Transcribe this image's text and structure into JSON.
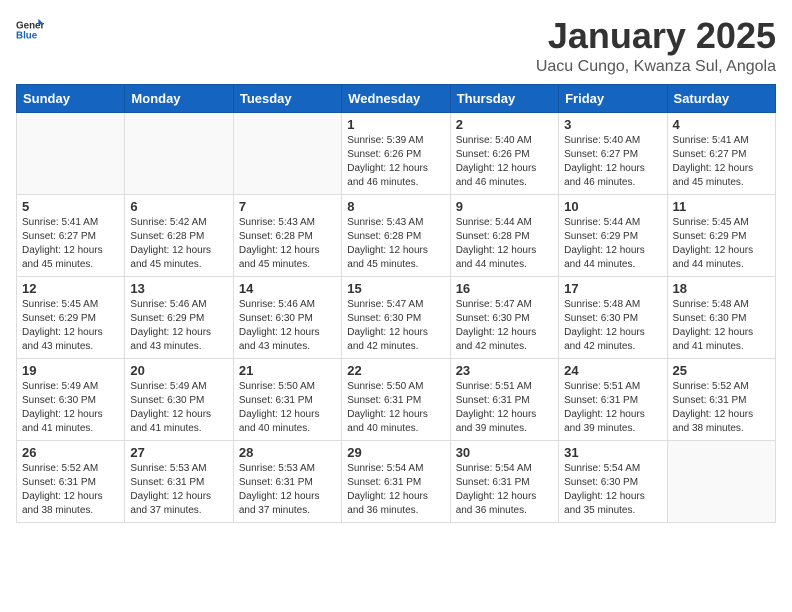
{
  "logo": {
    "general": "General",
    "blue": "Blue"
  },
  "header": {
    "month": "January 2025",
    "location": "Uacu Cungo, Kwanza Sul, Angola"
  },
  "weekdays": [
    "Sunday",
    "Monday",
    "Tuesday",
    "Wednesday",
    "Thursday",
    "Friday",
    "Saturday"
  ],
  "weeks": [
    [
      {
        "day": "",
        "info": ""
      },
      {
        "day": "",
        "info": ""
      },
      {
        "day": "",
        "info": ""
      },
      {
        "day": "1",
        "info": "Sunrise: 5:39 AM\nSunset: 6:26 PM\nDaylight: 12 hours\nand 46 minutes."
      },
      {
        "day": "2",
        "info": "Sunrise: 5:40 AM\nSunset: 6:26 PM\nDaylight: 12 hours\nand 46 minutes."
      },
      {
        "day": "3",
        "info": "Sunrise: 5:40 AM\nSunset: 6:27 PM\nDaylight: 12 hours\nand 46 minutes."
      },
      {
        "day": "4",
        "info": "Sunrise: 5:41 AM\nSunset: 6:27 PM\nDaylight: 12 hours\nand 45 minutes."
      }
    ],
    [
      {
        "day": "5",
        "info": "Sunrise: 5:41 AM\nSunset: 6:27 PM\nDaylight: 12 hours\nand 45 minutes."
      },
      {
        "day": "6",
        "info": "Sunrise: 5:42 AM\nSunset: 6:28 PM\nDaylight: 12 hours\nand 45 minutes."
      },
      {
        "day": "7",
        "info": "Sunrise: 5:43 AM\nSunset: 6:28 PM\nDaylight: 12 hours\nand 45 minutes."
      },
      {
        "day": "8",
        "info": "Sunrise: 5:43 AM\nSunset: 6:28 PM\nDaylight: 12 hours\nand 45 minutes."
      },
      {
        "day": "9",
        "info": "Sunrise: 5:44 AM\nSunset: 6:28 PM\nDaylight: 12 hours\nand 44 minutes."
      },
      {
        "day": "10",
        "info": "Sunrise: 5:44 AM\nSunset: 6:29 PM\nDaylight: 12 hours\nand 44 minutes."
      },
      {
        "day": "11",
        "info": "Sunrise: 5:45 AM\nSunset: 6:29 PM\nDaylight: 12 hours\nand 44 minutes."
      }
    ],
    [
      {
        "day": "12",
        "info": "Sunrise: 5:45 AM\nSunset: 6:29 PM\nDaylight: 12 hours\nand 43 minutes."
      },
      {
        "day": "13",
        "info": "Sunrise: 5:46 AM\nSunset: 6:29 PM\nDaylight: 12 hours\nand 43 minutes."
      },
      {
        "day": "14",
        "info": "Sunrise: 5:46 AM\nSunset: 6:30 PM\nDaylight: 12 hours\nand 43 minutes."
      },
      {
        "day": "15",
        "info": "Sunrise: 5:47 AM\nSunset: 6:30 PM\nDaylight: 12 hours\nand 42 minutes."
      },
      {
        "day": "16",
        "info": "Sunrise: 5:47 AM\nSunset: 6:30 PM\nDaylight: 12 hours\nand 42 minutes."
      },
      {
        "day": "17",
        "info": "Sunrise: 5:48 AM\nSunset: 6:30 PM\nDaylight: 12 hours\nand 42 minutes."
      },
      {
        "day": "18",
        "info": "Sunrise: 5:48 AM\nSunset: 6:30 PM\nDaylight: 12 hours\nand 41 minutes."
      }
    ],
    [
      {
        "day": "19",
        "info": "Sunrise: 5:49 AM\nSunset: 6:30 PM\nDaylight: 12 hours\nand 41 minutes."
      },
      {
        "day": "20",
        "info": "Sunrise: 5:49 AM\nSunset: 6:30 PM\nDaylight: 12 hours\nand 41 minutes."
      },
      {
        "day": "21",
        "info": "Sunrise: 5:50 AM\nSunset: 6:31 PM\nDaylight: 12 hours\nand 40 minutes."
      },
      {
        "day": "22",
        "info": "Sunrise: 5:50 AM\nSunset: 6:31 PM\nDaylight: 12 hours\nand 40 minutes."
      },
      {
        "day": "23",
        "info": "Sunrise: 5:51 AM\nSunset: 6:31 PM\nDaylight: 12 hours\nand 39 minutes."
      },
      {
        "day": "24",
        "info": "Sunrise: 5:51 AM\nSunset: 6:31 PM\nDaylight: 12 hours\nand 39 minutes."
      },
      {
        "day": "25",
        "info": "Sunrise: 5:52 AM\nSunset: 6:31 PM\nDaylight: 12 hours\nand 38 minutes."
      }
    ],
    [
      {
        "day": "26",
        "info": "Sunrise: 5:52 AM\nSunset: 6:31 PM\nDaylight: 12 hours\nand 38 minutes."
      },
      {
        "day": "27",
        "info": "Sunrise: 5:53 AM\nSunset: 6:31 PM\nDaylight: 12 hours\nand 37 minutes."
      },
      {
        "day": "28",
        "info": "Sunrise: 5:53 AM\nSunset: 6:31 PM\nDaylight: 12 hours\nand 37 minutes."
      },
      {
        "day": "29",
        "info": "Sunrise: 5:54 AM\nSunset: 6:31 PM\nDaylight: 12 hours\nand 36 minutes."
      },
      {
        "day": "30",
        "info": "Sunrise: 5:54 AM\nSunset: 6:31 PM\nDaylight: 12 hours\nand 36 minutes."
      },
      {
        "day": "31",
        "info": "Sunrise: 5:54 AM\nSunset: 6:30 PM\nDaylight: 12 hours\nand 35 minutes."
      },
      {
        "day": "",
        "info": ""
      }
    ]
  ]
}
